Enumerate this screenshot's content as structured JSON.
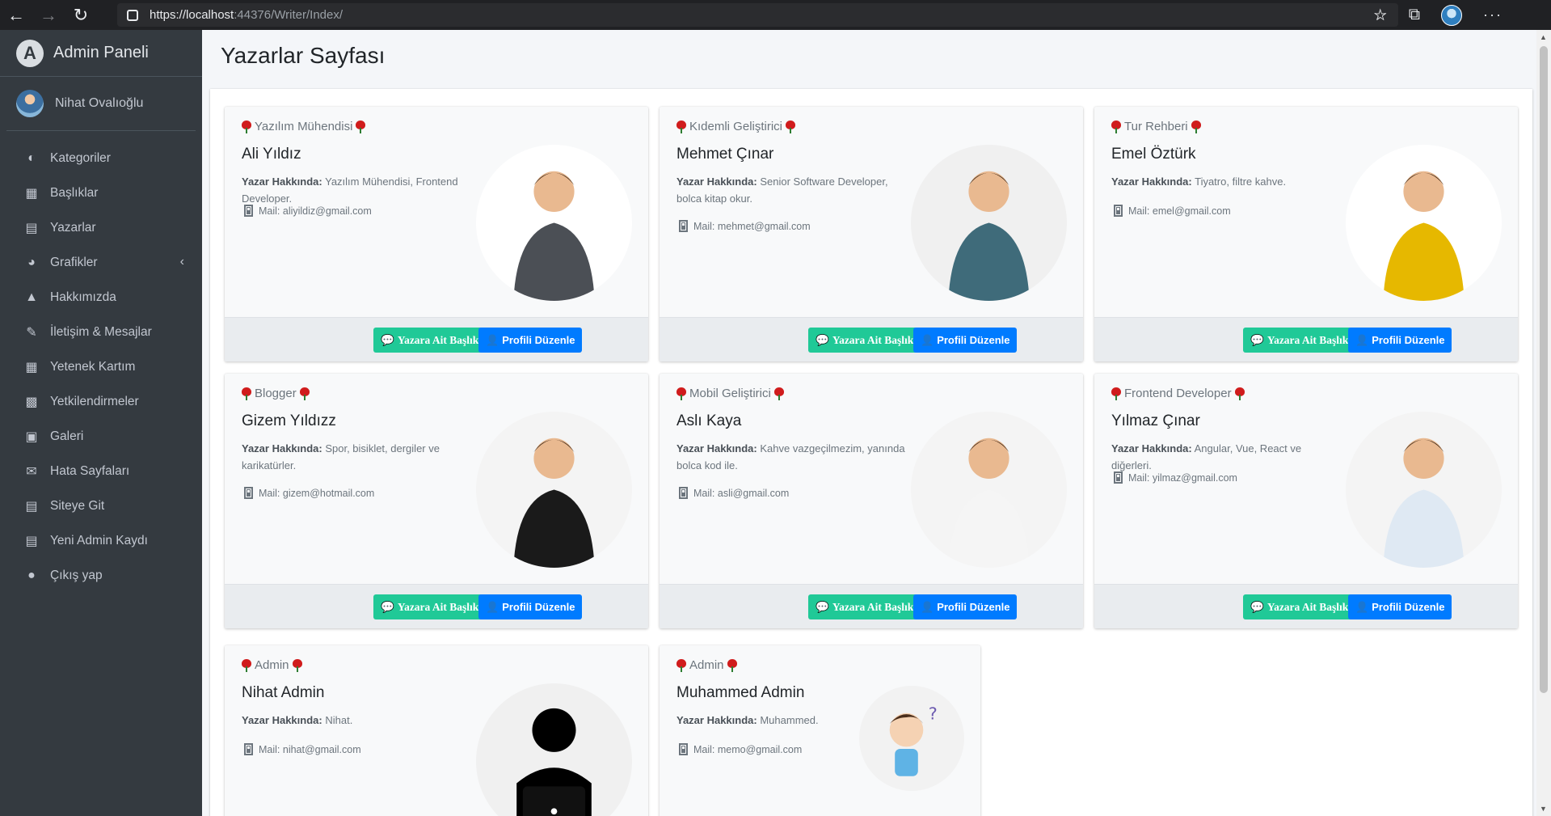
{
  "browser": {
    "url_host": "https://localhost",
    "url_rest": ":44376/Writer/Index/"
  },
  "sidebar": {
    "brand": "Admin Paneli",
    "user_name": "Nihat Ovalıoğlu",
    "items": [
      {
        "label": "Kategoriler",
        "icon": "tachometer-icon"
      },
      {
        "label": "Başlıklar",
        "icon": "grid-icon"
      },
      {
        "label": "Yazarlar",
        "icon": "file-icon"
      },
      {
        "label": "Grafikler",
        "icon": "pie-chart-icon"
      },
      {
        "label": "Hakkımızda",
        "icon": "tree-icon"
      },
      {
        "label": "İletişim & Mesajlar",
        "icon": "edit-icon"
      },
      {
        "label": "Yetenek Kartım",
        "icon": "table-icon"
      },
      {
        "label": "Yetkilendirmeler",
        "icon": "calendar-icon"
      },
      {
        "label": "Galeri",
        "icon": "image-icon"
      },
      {
        "label": "Hata Sayfaları",
        "icon": "envelope-icon"
      },
      {
        "label": "Siteye Git",
        "icon": "document-icon"
      },
      {
        "label": "Yeni Admin Kaydı",
        "icon": "document-icon"
      },
      {
        "label": "Çıkış yap",
        "icon": "apple-icon"
      }
    ]
  },
  "page": {
    "title": "Yazarlar Sayfası",
    "about_label": "Yazar Hakkında:",
    "btn_titles": "Yazara Ait Başlıklar",
    "btn_profile": "Profili Düzenle"
  },
  "writers": [
    {
      "role": "Yazılım Mühendisi",
      "name": "Ali Yıldız",
      "about": "Yazılım Mühendisi, Frontend Developer.",
      "mail": "Mail: aliyildiz@gmail.com"
    },
    {
      "role": "Kıdemli Geliştirici",
      "name": "Mehmet Çınar",
      "about": "Senior Software Developer, bolca kitap okur.",
      "mail": "Mail: mehmet@gmail.com"
    },
    {
      "role": "Tur Rehberi",
      "name": "Emel Öztürk",
      "about": "Tiyatro, filtre kahve.",
      "mail": "Mail: emel@gmail.com"
    },
    {
      "role": "Blogger",
      "name": "Gizem Yıldızz",
      "about": "Spor, bisiklet, dergiler ve karikatürler.",
      "mail": "Mail: gizem@hotmail.com"
    },
    {
      "role": "Mobil Geliştirici",
      "name": "Aslı Kaya",
      "about": "Kahve vazgeçilmezim, yanında bolca kod ile.",
      "mail": "Mail: asli@gmail.com"
    },
    {
      "role": "Frontend Developer",
      "name": "Yılmaz Çınar",
      "about": "Angular, Vue, React ve diğerleri.",
      "mail": "Mail: yilmaz@gmail.com"
    },
    {
      "role": "Admin",
      "name": "Nihat Admin",
      "about": "Nihat.",
      "mail": "Mail: nihat@gmail.com"
    },
    {
      "role": "Admin",
      "name": "Muhammed Admin",
      "about": "Muhammed.",
      "mail": "Mail: memo@gmail.com"
    }
  ]
}
